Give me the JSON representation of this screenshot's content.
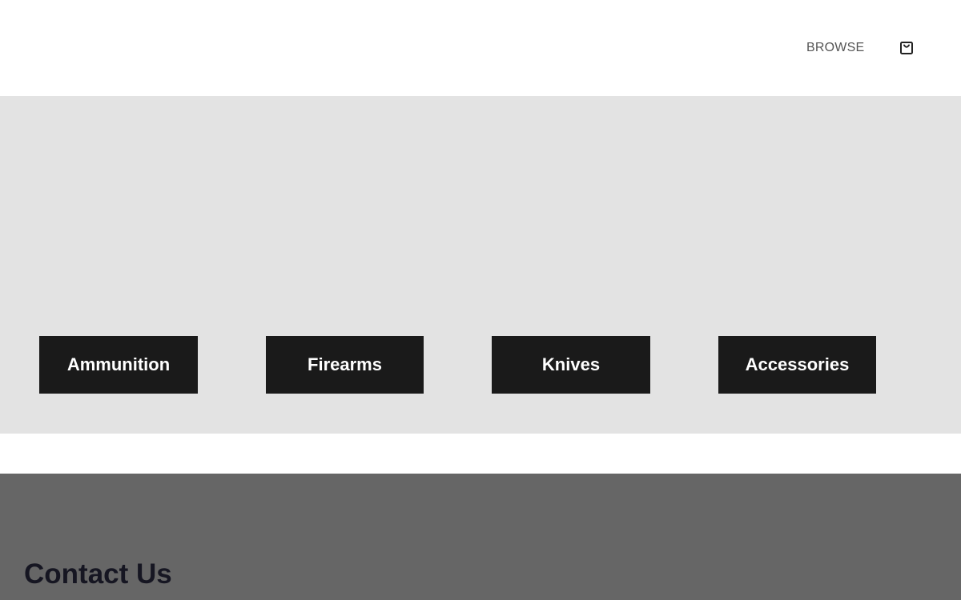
{
  "header": {
    "browse_label": "BROWSE",
    "cart_icon": "shopping-bag-icon"
  },
  "categories": [
    {
      "label": "Ammunition"
    },
    {
      "label": "Firearms"
    },
    {
      "label": "Knives"
    },
    {
      "label": "Accessories"
    }
  ],
  "footer": {
    "contact_title": "Contact Us"
  },
  "colors": {
    "hero_background": "#e3e3e3",
    "button_background": "#1a1a1a",
    "footer_background": "#666666"
  }
}
